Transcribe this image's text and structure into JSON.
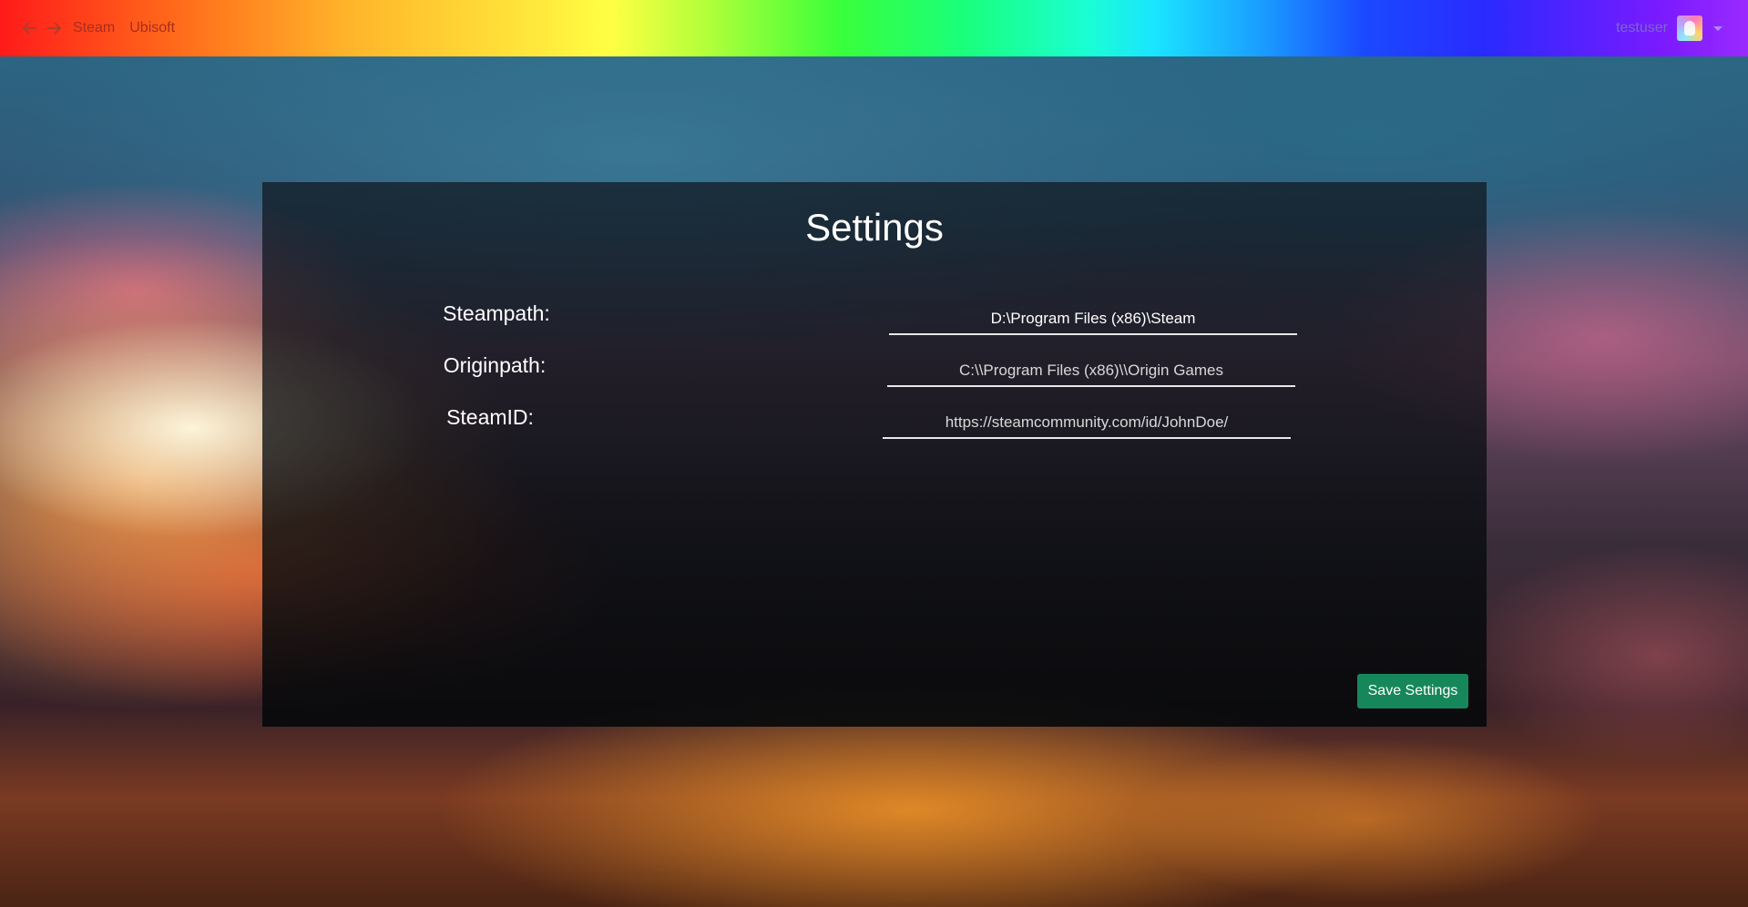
{
  "nav": {
    "back_icon": "arrow-left-icon",
    "forward_icon": "arrow-right-icon",
    "links": [
      "Steam",
      "Ubisoft"
    ],
    "username": "testuser",
    "avatar_icon": "avatar",
    "menu_icon": "chevron-down-icon"
  },
  "settings": {
    "title": "Settings",
    "fields": [
      {
        "label": "Steampath:",
        "value": "D:\\Program Files (x86)\\Steam"
      },
      {
        "label": "Originpath:",
        "value": "C:\\\\Program Files (x86)\\\\Origin Games"
      },
      {
        "label": "SteamID:",
        "value": "https://steamcommunity.com/id/JohnDoe/"
      }
    ],
    "save_label": "Save Settings"
  },
  "colors": {
    "save_button": "#16875a",
    "panel": "#0a0e12"
  }
}
